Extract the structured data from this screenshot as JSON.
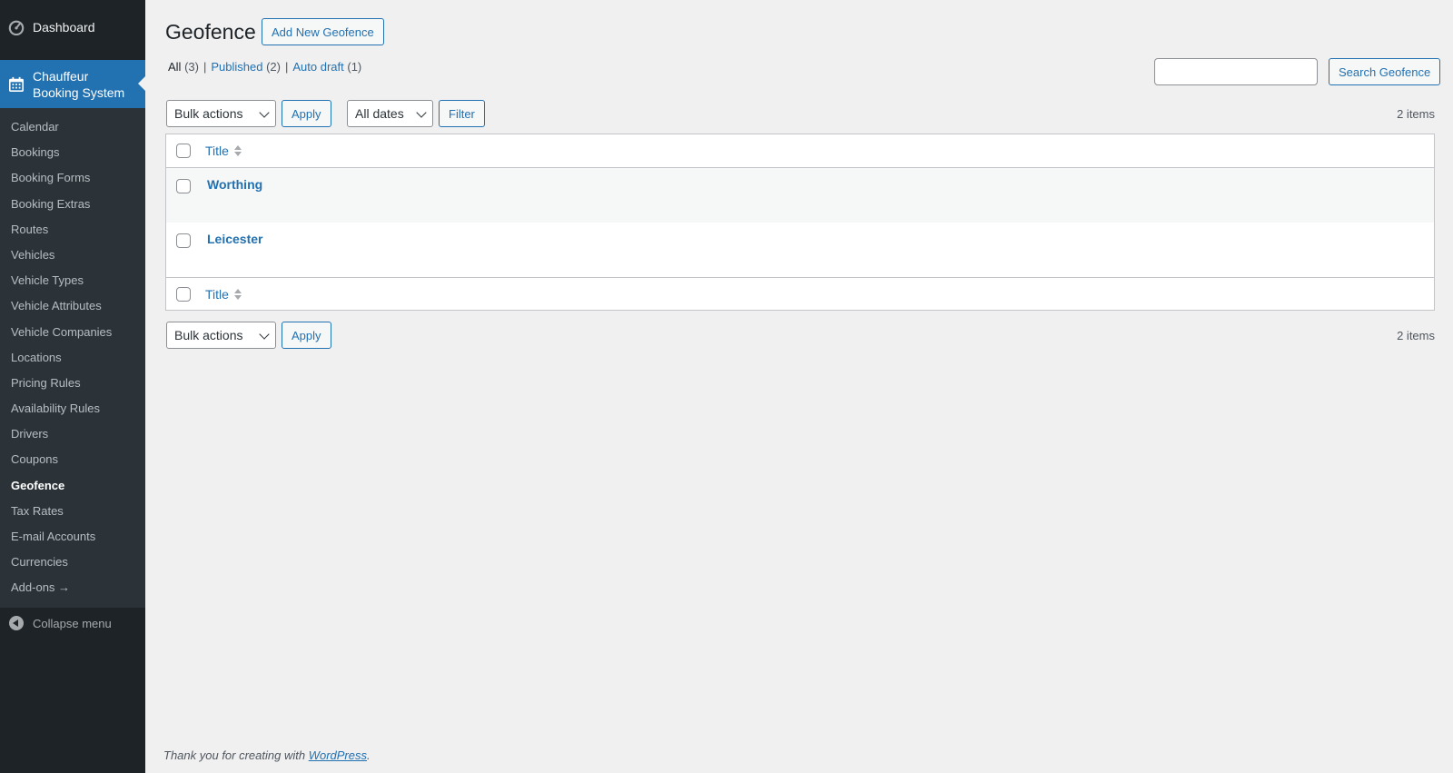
{
  "sidebar": {
    "dashboard_label": "Dashboard",
    "plugin_label_line1": "Chauffeur",
    "plugin_label_line2": "Booking System",
    "items": [
      {
        "label": "Calendar"
      },
      {
        "label": "Bookings"
      },
      {
        "label": "Booking Forms"
      },
      {
        "label": "Booking Extras"
      },
      {
        "label": "Routes"
      },
      {
        "label": "Vehicles"
      },
      {
        "label": "Vehicle Types"
      },
      {
        "label": "Vehicle Attributes"
      },
      {
        "label": "Vehicle Companies"
      },
      {
        "label": "Locations"
      },
      {
        "label": "Pricing Rules"
      },
      {
        "label": "Availability Rules"
      },
      {
        "label": "Drivers"
      },
      {
        "label": "Coupons"
      },
      {
        "label": "Geofence",
        "current": true
      },
      {
        "label": "Tax Rates"
      },
      {
        "label": "E-mail Accounts"
      },
      {
        "label": "Currencies"
      },
      {
        "label": "Add-ons →"
      }
    ],
    "collapse_label": "Collapse menu"
  },
  "header": {
    "title": "Geofence",
    "add_new_label": "Add New Geofence"
  },
  "filters": {
    "all_label": "All",
    "all_count": "(3)",
    "published_label": "Published",
    "published_count": "(2)",
    "autodraft_label": "Auto draft",
    "autodraft_count": "(1)",
    "separator": "|"
  },
  "search": {
    "value": "",
    "button_label": "Search Geofence"
  },
  "toolbar": {
    "bulk_actions": "Bulk actions",
    "apply": "Apply",
    "all_dates": "All dates",
    "filter": "Filter",
    "items_count": "2 items"
  },
  "table": {
    "column_title": "Title",
    "rows": [
      {
        "title": "Worthing"
      },
      {
        "title": "Leicester"
      }
    ]
  },
  "footer": {
    "text_prefix": "Thank you for creating with ",
    "link": "WordPress",
    "text_suffix": "."
  },
  "colors": {
    "accent": "#2271b1",
    "sidebar_bg": "#1d2327",
    "submenu_bg": "#2c3338",
    "page_bg": "#f0f0f1"
  }
}
